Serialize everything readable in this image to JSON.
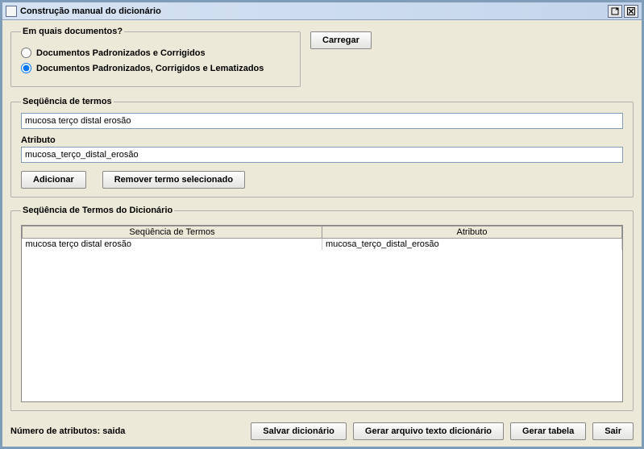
{
  "window": {
    "title": "Construção manual do dicionário"
  },
  "docs_group": {
    "legend": "Em quais documentos?",
    "option1": "Documentos Padronizados e Corrigidos",
    "option2": "Documentos Padronizados, Corrigidos e Lematizados",
    "selected": "option2"
  },
  "carregar_label": "Carregar",
  "seq_group": {
    "legend": "Seqüência de termos",
    "seq_label": "Seqüência de termos",
    "seq_value": "mucosa terço distal erosão",
    "attr_label": "Atributo",
    "attr_value": "mucosa_terço_distal_erosão",
    "adicionar_label": "Adicionar",
    "remover_label": "Remover termo selecionado"
  },
  "dict_group": {
    "legend": "Seqüência de Termos do Dicionário",
    "col1": "Seqüência de Termos",
    "col2": "Atributo",
    "rows": [
      {
        "seq": "mucosa terço distal erosão",
        "attr": "mucosa_terço_distal_erosão"
      }
    ]
  },
  "footer": {
    "count_label": "Número de atributos:  saida",
    "salvar": "Salvar dicionário",
    "gerar_arquivo": "Gerar arquivo texto dicionário",
    "gerar_tabela": "Gerar tabela",
    "sair": "Sair"
  }
}
